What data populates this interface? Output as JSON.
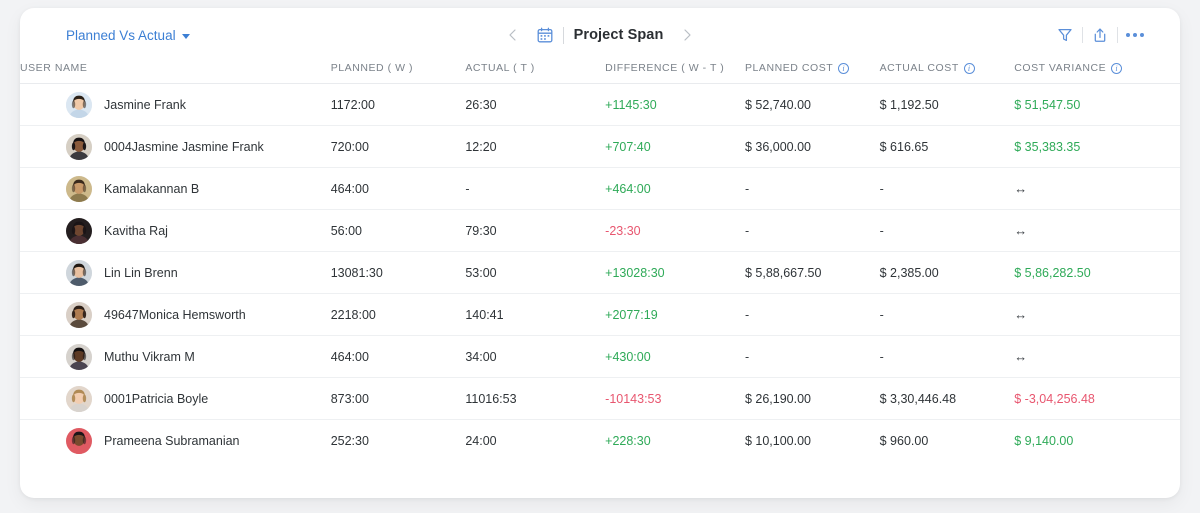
{
  "toolbar": {
    "report_name": "Planned Vs Actual",
    "caret_icon": "chevron-down-icon",
    "prev_icon": "chevron-left-icon",
    "next_icon": "chevron-right-icon",
    "calendar_icon": "calendar-icon",
    "span_title": "Project Span",
    "filter_icon": "filter-icon",
    "export_icon": "upload-export-icon",
    "more_icon": "more-options-icon"
  },
  "colors": {
    "accent_blue": "#3c7fd4",
    "icon_blue": "#5b8fd9",
    "positive_green": "#2faa58",
    "negative_red": "#e8566f",
    "header_gray": "#7b828a",
    "text_dark": "#2f3438",
    "page_bg": "#f2f3f5",
    "card_bg": "#ffffff",
    "row_border": "#eef0f2"
  },
  "table": {
    "columns": [
      {
        "label": "USER NAME",
        "info": false
      },
      {
        "label": "PLANNED ( W )",
        "info": false
      },
      {
        "label": "ACTUAL ( T )",
        "info": false
      },
      {
        "label": "DIFFERENCE ( W - T )",
        "info": false
      },
      {
        "label": "PLANNED COST",
        "info": true
      },
      {
        "label": "ACTUAL COST",
        "info": true
      },
      {
        "label": "COST VARIANCE",
        "info": true
      }
    ],
    "rows": [
      {
        "user": "Jasmine Frank",
        "avatar": "avatar-photo-1",
        "planned": "1172:00",
        "actual": "26:30",
        "difference": "+1145:30",
        "difference_sign": "pos",
        "planned_cost": "$ 52,740.00",
        "actual_cost": "$ 1,192.50",
        "cost_variance": "$ 51,547.50",
        "cost_variance_sign": "pos"
      },
      {
        "user": "0004Jasmine Jasmine Frank",
        "avatar": "avatar-photo-2",
        "planned": "720:00",
        "actual": "12:20",
        "difference": "+707:40",
        "difference_sign": "pos",
        "planned_cost": "$ 36,000.00",
        "actual_cost": "$ 616.65",
        "cost_variance": "$ 35,383.35",
        "cost_variance_sign": "pos"
      },
      {
        "user": "Kamalakannan B",
        "avatar": "avatar-photo-3",
        "planned": "464:00",
        "actual": "-",
        "difference": "+464:00",
        "difference_sign": "pos",
        "planned_cost": "-",
        "actual_cost": "-",
        "cost_variance": "↔",
        "cost_variance_sign": "neutral"
      },
      {
        "user": "Kavitha Raj",
        "avatar": "avatar-photo-4",
        "planned": "56:00",
        "actual": "79:30",
        "difference": "-23:30",
        "difference_sign": "neg",
        "planned_cost": "-",
        "actual_cost": "-",
        "cost_variance": "↔",
        "cost_variance_sign": "neutral"
      },
      {
        "user": "Lin Lin Brenn",
        "avatar": "avatar-photo-5",
        "planned": "13081:30",
        "actual": "53:00",
        "difference": "+13028:30",
        "difference_sign": "pos",
        "planned_cost": "$ 5,88,667.50",
        "actual_cost": "$ 2,385.00",
        "cost_variance": "$ 5,86,282.50",
        "cost_variance_sign": "pos"
      },
      {
        "user": "49647Monica Hemsworth",
        "avatar": "avatar-photo-6",
        "planned": "2218:00",
        "actual": "140:41",
        "difference": "+2077:19",
        "difference_sign": "pos",
        "planned_cost": "-",
        "actual_cost": "-",
        "cost_variance": "↔",
        "cost_variance_sign": "neutral"
      },
      {
        "user": "Muthu Vikram M",
        "avatar": "avatar-photo-7",
        "planned": "464:00",
        "actual": "34:00",
        "difference": "+430:00",
        "difference_sign": "pos",
        "planned_cost": "-",
        "actual_cost": "-",
        "cost_variance": "↔",
        "cost_variance_sign": "neutral"
      },
      {
        "user": "0001Patricia Boyle",
        "avatar": "avatar-photo-8",
        "planned": "873:00",
        "actual": "11016:53",
        "difference": "-10143:53",
        "difference_sign": "neg",
        "planned_cost": "$ 26,190.00",
        "actual_cost": "$ 3,30,446.48",
        "cost_variance": "$ -3,04,256.48",
        "cost_variance_sign": "neg"
      },
      {
        "user": "Prameena Subramanian",
        "avatar": "avatar-photo-9",
        "planned": "252:30",
        "actual": "24:00",
        "difference": "+228:30",
        "difference_sign": "pos",
        "planned_cost": "$ 10,100.00",
        "actual_cost": "$ 960.00",
        "cost_variance": "$ 9,140.00",
        "cost_variance_sign": "pos"
      }
    ]
  }
}
